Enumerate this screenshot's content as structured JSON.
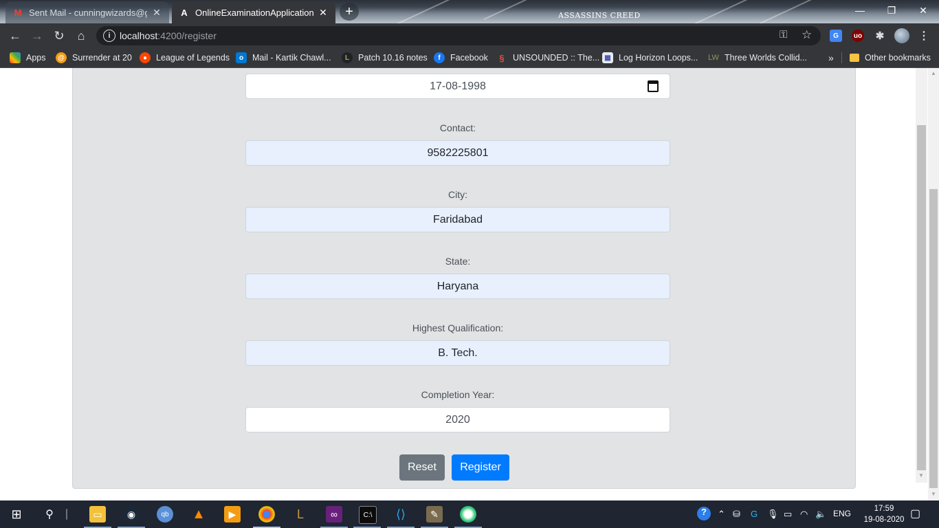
{
  "browser": {
    "tabs": [
      {
        "title": "Sent Mail - cunningwizards@gm",
        "favicon": "gmail-icon",
        "active": false
      },
      {
        "title": "OnlineExaminationApplication",
        "favicon": "angular-icon",
        "active": true
      }
    ],
    "title_logo": "ASSASSINS CREED",
    "url_host": "localhost",
    "url_path": ":4200/register"
  },
  "bookmarks": [
    {
      "label": "Apps",
      "icon": "apps-grid-icon",
      "color": "#ea4335"
    },
    {
      "label": "Surrender at 20",
      "icon": "surrender-icon",
      "color": "#f39c12"
    },
    {
      "label": "League of Legends",
      "icon": "reddit-icon",
      "color": "#ff4500"
    },
    {
      "label": "Mail - Kartik Chawl...",
      "icon": "outlook-icon",
      "color": "#0078d4"
    },
    {
      "label": "Patch 10.16 notes",
      "icon": "lol-icon",
      "color": "#c89b3c"
    },
    {
      "label": "Facebook",
      "icon": "facebook-icon",
      "color": "#1877f2"
    },
    {
      "label": "UNSOUNDED :: The...",
      "icon": "unsounded-icon",
      "color": "#c0392b"
    },
    {
      "label": "Log Horizon Loops...",
      "icon": "document-icon",
      "color": "#3f51b5"
    },
    {
      "label": "Three Worlds Collid...",
      "icon": "lw-icon",
      "color": "#6b8e23"
    }
  ],
  "bookmarks_more": "»",
  "other_bookmarks": "Other bookmarks",
  "form": {
    "dob_value": "17-08-1998",
    "contact_label": "Contact:",
    "contact_value": "9582225801",
    "city_label": "City:",
    "city_value": "Faridabad",
    "state_label": "State:",
    "state_value": "Haryana",
    "qualification_label": "Highest Qualification:",
    "qualification_value": "B. Tech.",
    "year_label": "Completion Year:",
    "year_value": "2020",
    "reset_label": "Reset",
    "register_label": "Register"
  },
  "taskbar": {
    "language": "ENG",
    "time": "17:59",
    "date": "19-08-2020"
  },
  "colors": {
    "primary": "#007bff",
    "secondary": "#6c757d",
    "card_bg": "#e2e3e5",
    "autofill_bg": "#e8f0fe"
  }
}
